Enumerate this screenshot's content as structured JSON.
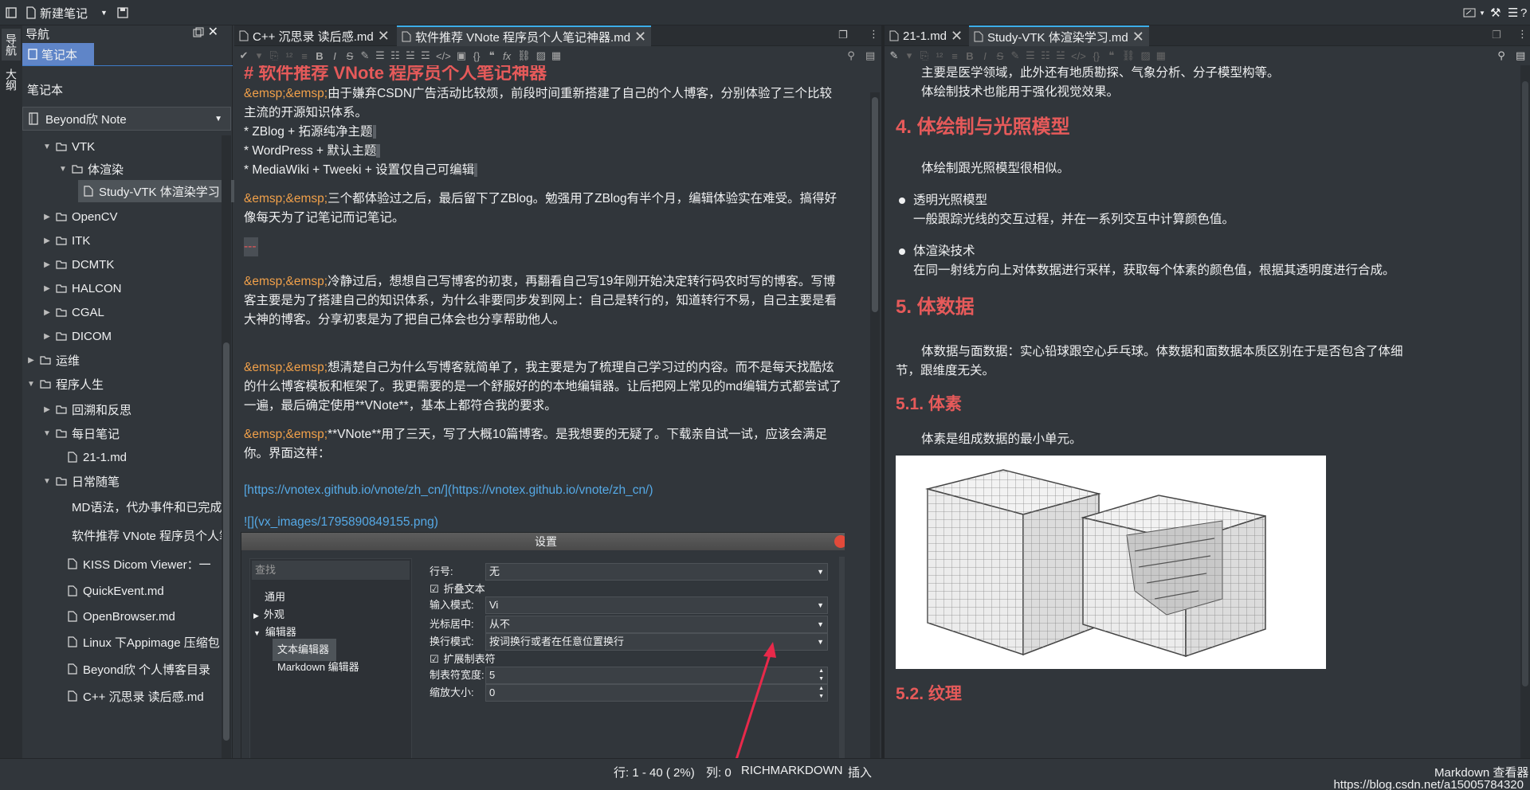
{
  "topbar": {
    "new_note": "新建笔记"
  },
  "dock": {
    "tab_nav": "导航",
    "tab_outline": "大纲"
  },
  "nav": {
    "header": "导航",
    "notebook_tab": "笔记本",
    "notebook_label": "笔记本",
    "notebook_selected": "Beyond欣 Note",
    "tree": [
      {
        "label": "VTK",
        "type": "folder",
        "level": 1,
        "expanded": true
      },
      {
        "label": "体渲染",
        "type": "folder",
        "level": 2,
        "expanded": true
      },
      {
        "label": "Study-VTK 体渲染学习",
        "type": "note",
        "level": 3,
        "selected": true
      },
      {
        "label": "OpenCV",
        "type": "folder",
        "level": 1,
        "expanded": false
      },
      {
        "label": "ITK",
        "type": "folder",
        "level": 1,
        "expanded": false
      },
      {
        "label": "DCMTK",
        "type": "folder",
        "level": 1,
        "expanded": false
      },
      {
        "label": "HALCON",
        "type": "folder",
        "level": 1,
        "expanded": false
      },
      {
        "label": "CGAL",
        "type": "folder",
        "level": 1,
        "expanded": false
      },
      {
        "label": "DICOM",
        "type": "folder",
        "level": 1,
        "expanded": false
      },
      {
        "label": "运维",
        "type": "folder",
        "level": 0,
        "expanded": false
      },
      {
        "label": "程序人生",
        "type": "folder",
        "level": 0,
        "expanded": true
      },
      {
        "label": "回溯和反思",
        "type": "folder",
        "level": 1,
        "expanded": false
      },
      {
        "label": "每日笔记",
        "type": "folder",
        "level": 1,
        "expanded": true
      },
      {
        "label": "21-1.md",
        "type": "note",
        "level": 2
      },
      {
        "label": "日常随笔",
        "type": "folder",
        "level": 1,
        "expanded": true
      },
      {
        "label": "MD语法，代办事件和已完成",
        "type": "note",
        "level": 2
      },
      {
        "label": "软件推荐 VNote  程序员个人笔记神器",
        "type": "note",
        "level": 2
      },
      {
        "label": "KISS Dicom Viewer：一",
        "type": "note",
        "level": 2
      },
      {
        "label": "QuickEvent.md",
        "type": "note",
        "level": 2
      },
      {
        "label": "OpenBrowser.md",
        "type": "note",
        "level": 2
      },
      {
        "label": "Linux 下Appimage 压缩包",
        "type": "note",
        "level": 2
      },
      {
        "label": "Beyond欣 个人博客目录",
        "type": "note",
        "level": 2
      },
      {
        "label": "C++ 沉思录 读后感.md",
        "type": "note",
        "level": 2
      }
    ]
  },
  "left_editor": {
    "tabs": [
      "C++ 沉思录 读后感.md",
      "软件推荐 VNote  程序员个人笔记神器.md"
    ],
    "active_tab": 1,
    "lines": {
      "h1": "# 软件推荐 VNote  程序员个人笔记神器",
      "p1_amp": "&emsp;&emsp;",
      "p1": "由于嫌弃CSDN广告活动比较烦，前段时间重新搭建了自己的个人博客，分别体验了三个比较主流的开源知识体系。",
      "li1": "* ZBlog + 拓源纯净主题",
      "li2": "* WordPress  + 默认主题",
      "li3": "* MediaWiki + Tweeki + 设置仅自己可编辑",
      "p2_amp": "&emsp;&emsp;",
      "p2": "三个都体验过之后，最后留下了ZBlog。勉强用了ZBlog有半个月，编辑体验实在难受。搞得好像每天为了记笔记而记笔记。",
      "hr": "---",
      "p3_amp": "&emsp;&emsp;",
      "p3": "冷静过后，想想自己写博客的初衷，再翻看自己写19年刚开始决定转行码农时写的博客。写博客主要是为了搭建自己的知识体系，为什么非要同步发到网上：自己是转行的，知道转行不易，自己主要是看大神的博客。分享初衷是为了把自己体会也分享帮助他人。",
      "p4_amp": "&emsp;&emsp;",
      "p4": "想清楚自己为什么写博客就简单了，我主要是为了梳理自己学习过的内容。而不是每天找酷炫的什么博客模板和框架了。我更需要的是一个舒服好的的本地编辑器。让后把网上常见的md编辑方式都尝试了一遍，最后确定使用**VNote**，基本上都符合我的要求。",
      "p5_amp": "&emsp;&emsp;",
      "p5": "**VNote**用了三天，写了大概10篇博客。是我想要的无疑了。下载亲自试一试，应该会满足你。界面这样：",
      "link": "[https://vnotex.github.io/vnote/zh_cn/](https://vnotex.github.io/vnote/zh_cn/)",
      "img": "![](vx_images/1795890849155.png)"
    }
  },
  "settings_dialog": {
    "title": "设置",
    "search_placeholder": "查找",
    "categories": [
      "通用",
      "外观",
      "编辑器",
      "文本编辑器",
      "Markdown 编辑器"
    ],
    "fields": {
      "line_number_label": "行号:",
      "line_number_value": "无",
      "fold_text_label": "折叠文本",
      "input_mode_label": "输入模式:",
      "input_mode_value": "Vi",
      "cursor_center_label": "光标居中:",
      "cursor_center_value": "从不",
      "wrap_mode_label": "换行模式:",
      "wrap_mode_value": "按词换行或者在任意位置换行",
      "expand_tab_label": "扩展制表符",
      "tab_width_label": "制表符宽度:",
      "tab_width_value": "5",
      "zoom_label": "缩放大小:",
      "zoom_value": "0"
    }
  },
  "right_editor": {
    "tabs": [
      "21-1.md",
      "Study-VTK 体渲染学习.md"
    ],
    "active_tab": 1,
    "content": {
      "p_top1": "主要是医学领域，此外还有地质勘探、气象分析、分子模型构等。",
      "p_top2": "体绘制技术也能用于强化视觉效果。",
      "h2_4": "4. 体绘制与光照模型",
      "p4": "体绘制跟光照模型很相似。",
      "b1_title": "透明光照模型",
      "b1_text": "一般跟踪光线的交互过程，并在一系列交互中计算颜色值。",
      "b2_title": "体渲染技术",
      "b2_text": "在同一射线方向上对体数据进行采样，获取每个体素的颜色值，根据其透明度进行合成。",
      "h2_5": "5. 体数据",
      "p5": "体数据与面数据：实心铅球跟空心乒乓球。体数据和面数据本质区别在于是否包含了体细节，跟维度无关。",
      "h3_51": "5.1. 体素",
      "p51": "体素是组成数据的最小单元。",
      "h3_52": "5.2. 纹理"
    }
  },
  "status": {
    "position": "行: 1 - 40 ( 2%)",
    "column": "列: 0",
    "mode": "RICHMARKDOWN",
    "insert": "插入",
    "viewer": "Markdown 查看器",
    "watermark": "https://blog.csdn.net/a15005784320"
  }
}
